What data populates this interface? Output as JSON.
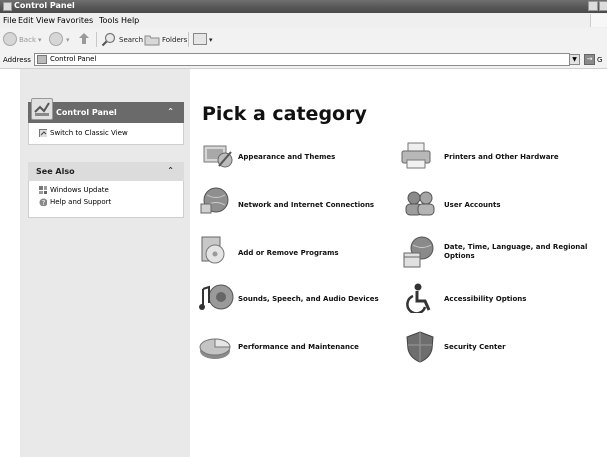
{
  "window": {
    "title": "Control Panel"
  },
  "menu": [
    "File",
    "Edit",
    "View",
    "Favorites",
    "Tools",
    "Help"
  ],
  "toolbar": {
    "back": "Back",
    "search": "Search",
    "folders": "Folders"
  },
  "address": {
    "label": "Address",
    "value": "Control Panel",
    "go_partial": "G"
  },
  "sidebar": {
    "control_panel": {
      "title": "Control Panel",
      "links": [
        "Switch to Classic View"
      ]
    },
    "see_also": {
      "title": "See Also",
      "links": [
        "Windows Update",
        "Help and Support"
      ]
    }
  },
  "main": {
    "heading": "Pick a category",
    "categories": [
      {
        "label": "Appearance and Themes",
        "icon": "appearance-themes-icon"
      },
      {
        "label": "Printers and Other Hardware",
        "icon": "printer-icon"
      },
      {
        "label": "Network and Internet Connections",
        "icon": "network-globe-icon"
      },
      {
        "label": "User Accounts",
        "icon": "user-accounts-icon"
      },
      {
        "label": "Add or Remove Programs",
        "icon": "add-remove-programs-icon"
      },
      {
        "label": "Date, Time, Language, and Regional Options",
        "icon": "date-time-globe-icon"
      },
      {
        "label": "Sounds, Speech, and Audio Devices",
        "icon": "sound-icon"
      },
      {
        "label": "Accessibility Options",
        "icon": "accessibility-icon"
      },
      {
        "label": "Performance and Maintenance",
        "icon": "pie-chart-icon"
      },
      {
        "label": "Security Center",
        "icon": "shield-icon"
      }
    ]
  }
}
